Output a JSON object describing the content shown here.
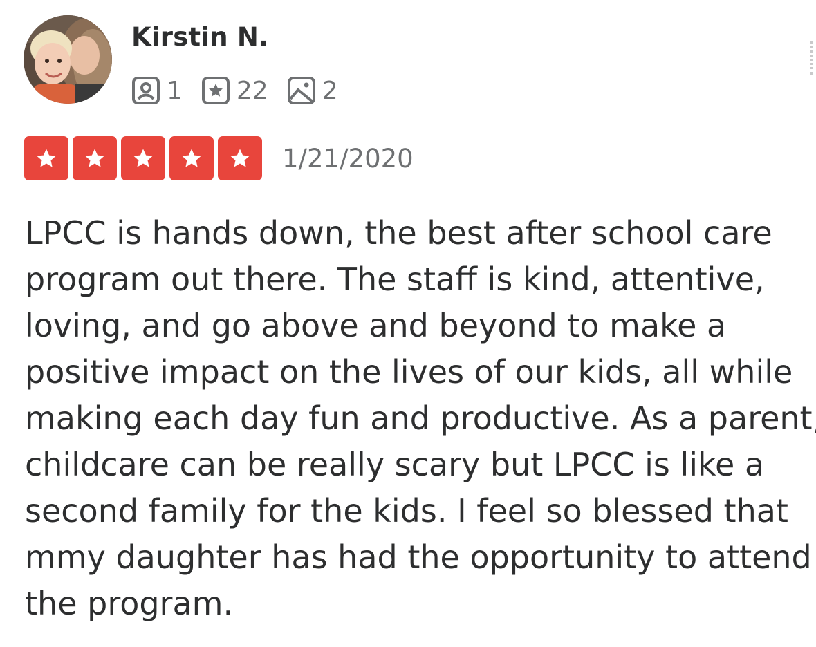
{
  "user": {
    "name": "Kirstin N.",
    "stats": {
      "friends": "1",
      "reviews": "22",
      "photos": "2"
    },
    "stat_icons": [
      "friends-icon",
      "reviews-icon",
      "photos-icon"
    ]
  },
  "review": {
    "rating": 5,
    "rating_max": 5,
    "date": "1/21/2020",
    "text_lines": [
      "LPCC is hands down, the best after school care",
      "program out there. The staff is kind, attentive,",
      "loving, and go above and beyond to make a",
      "positive impact on the lives of our kids, all while",
      "making each day fun and productive. As a parent,",
      "childcare can be really scary but LPCC is like a",
      "second family for the kids. I feel so blessed that",
      "mmy daughter has had the opportunity to attend",
      "the program."
    ]
  },
  "colors": {
    "star_background": "#e8453c",
    "text_primary": "#2d2e2f",
    "text_secondary": "#6e7072"
  }
}
